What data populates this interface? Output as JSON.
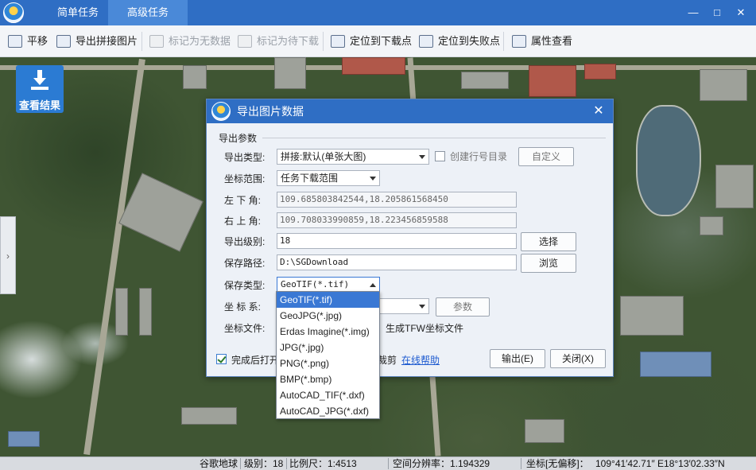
{
  "titlebar": {
    "tabs": [
      "简单任务",
      "高级任务"
    ],
    "min": "—",
    "max": "□",
    "close": "✕"
  },
  "toolbar": {
    "items": [
      {
        "label": "平移",
        "icon": "hand-pan-icon",
        "enabled": true
      },
      {
        "label": "导出拼接图片",
        "icon": "export-image-icon",
        "enabled": true
      },
      {
        "label": "标记为无数据",
        "icon": "mark-nodata-icon",
        "enabled": false
      },
      {
        "label": "标记为待下载",
        "icon": "mark-pending-icon",
        "enabled": false
      },
      {
        "label": "定位到下载点",
        "icon": "locate-downloaded-icon",
        "enabled": true
      },
      {
        "label": "定位到失败点",
        "icon": "locate-failed-icon",
        "enabled": true
      },
      {
        "label": "属性查看",
        "icon": "properties-icon",
        "enabled": true
      }
    ]
  },
  "download_button": {
    "label": "查看结果",
    "icon": "download-icon"
  },
  "side_handle": {
    "label": "›"
  },
  "dialog": {
    "title": "导出图片数据",
    "close": "✕",
    "group": "导出参数",
    "export_type_label": "导出类型:",
    "export_type_value": "拼接:默认(单张大图)",
    "create_row_dir_label": "创建行号目录",
    "custom_button": "自定义",
    "coord_range_label": "坐标范围:",
    "coord_range_value": "任务下载范围",
    "lower_left_label": "左 下 角:",
    "lower_left_value": "109.685803842544,18.205861568450",
    "upper_right_label": "右 上 角:",
    "upper_right_value": "109.708033990859,18.223456859588",
    "export_level_label": "导出级别:",
    "export_level_value": "18",
    "select_button": "选择",
    "save_path_label": "保存路径:",
    "save_path_value": "D:\\SGDownload",
    "browse_button": "浏览",
    "save_type_label": "保存类型:",
    "save_type_value": "GeoTIF(*.tif)",
    "coord_sys_label": "坐 标 系:",
    "params_button": "参数",
    "coord_file_label": "坐标文件:",
    "tfw_label": "生成TFW坐标文件",
    "open_after_label": "完成后打开",
    "crop_label": "裁剪",
    "help_link": "在线帮助",
    "export_button": "输出(E)",
    "close_button": "关闭(X)",
    "save_type_options": [
      "GeoTIF(*.tif)",
      "GeoJPG(*.jpg)",
      "Erdas Imagine(*.img)",
      "JPG(*.jpg)",
      "PNG(*.png)",
      "BMP(*.bmp)",
      "AutoCAD_TIF(*.dxf)",
      "AutoCAD_JPG(*.dxf)"
    ]
  },
  "statusbar": {
    "source": "谷歌地球",
    "level": "级别：18",
    "scale": "比例尺：1:4513",
    "resolution": "空间分辨率：1.194329",
    "coord_label": "坐标[无偏移]：",
    "coord_value": "109°41′42.71″ E18°13′02.33″N"
  }
}
